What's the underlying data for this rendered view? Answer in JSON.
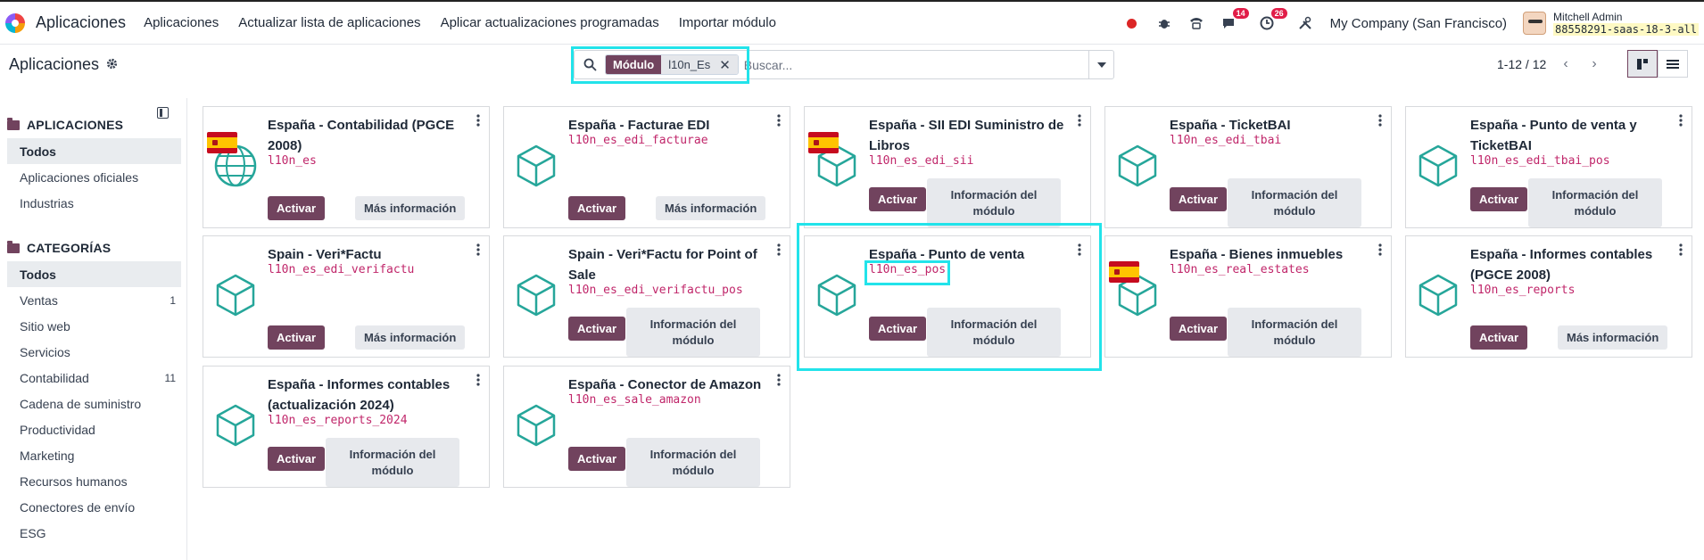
{
  "navbar": {
    "brand": "Aplicaciones",
    "links": [
      "Aplicaciones",
      "Actualizar lista de aplicaciones",
      "Aplicar actualizaciones programadas",
      "Importar módulo"
    ],
    "messages_badge": "14",
    "activities_badge": "26",
    "company": "My Company (San Francisco)",
    "user_name": "Mitchell Admin",
    "database": "88558291-saas-18-3-all"
  },
  "control": {
    "title": "Aplicaciones",
    "facet_label": "Módulo",
    "facet_value": "l10n_Es",
    "search_placeholder": "Buscar...",
    "pager": "1-12 / 12"
  },
  "sidebar": {
    "apps_header": "APLICACIONES",
    "apps_items": [
      {
        "label": "Todos",
        "count": ""
      },
      {
        "label": "Aplicaciones oficiales",
        "count": ""
      },
      {
        "label": "Industrias",
        "count": ""
      }
    ],
    "categories_header": "CATEGORÍAS",
    "category_items": [
      {
        "label": "Todos",
        "count": ""
      },
      {
        "label": "Ventas",
        "count": "1"
      },
      {
        "label": "Sitio web",
        "count": ""
      },
      {
        "label": "Servicios",
        "count": ""
      },
      {
        "label": "Contabilidad",
        "count": "11"
      },
      {
        "label": "Cadena de suministro",
        "count": ""
      },
      {
        "label": "Productividad",
        "count": ""
      },
      {
        "label": "Marketing",
        "count": ""
      },
      {
        "label": "Recursos humanos",
        "count": ""
      },
      {
        "label": "Conectores de envío",
        "count": ""
      },
      {
        "label": "ESG",
        "count": ""
      }
    ]
  },
  "buttons": {
    "activate": "Activar",
    "more_info": "Más información",
    "module_info": "Información del módulo"
  },
  "colors": {
    "primary": "#71435e",
    "technical_name": "#c0266a",
    "icon_teal": "#26a69a",
    "highlight": "#22e3ea"
  },
  "cards": [
    {
      "title": "España - Contabilidad (PGCE 2008)",
      "tech": "l10n_es",
      "icon": "globe-icon",
      "flag": true,
      "info": "more"
    },
    {
      "title": "España - Facturae EDI",
      "tech": "l10n_es_edi_facturae",
      "icon": "cube-icon",
      "flag": false,
      "info": "more"
    },
    {
      "title": "España - SII EDI Suministro de Libros",
      "tech": "l10n_es_edi_sii",
      "icon": "cube-icon",
      "flag": true,
      "info": "module"
    },
    {
      "title": "España - TicketBAI",
      "tech": "l10n_es_edi_tbai",
      "icon": "cube-icon",
      "flag": false,
      "info": "module"
    },
    {
      "title": "España - Punto de venta y TicketBAI",
      "tech": "l10n_es_edi_tbai_pos",
      "icon": "cube-icon",
      "flag": false,
      "info": "module"
    },
    {
      "title": "Spain - Veri*Factu",
      "tech": "l10n_es_edi_verifactu",
      "icon": "cube-icon",
      "flag": false,
      "info": "more"
    },
    {
      "title": "Spain - Veri*Factu for Point of Sale",
      "tech": "l10n_es_edi_verifactu_pos",
      "icon": "cube-icon",
      "flag": false,
      "info": "module"
    },
    {
      "title": "España - Punto de venta",
      "tech": "l10n_es_pos",
      "icon": "cube-icon",
      "flag": false,
      "info": "module"
    },
    {
      "title": "España - Bienes inmuebles",
      "tech": "l10n_es_real_estates",
      "icon": "cube-icon",
      "flag": true,
      "info": "module"
    },
    {
      "title": "España - Informes contables (PGCE 2008)",
      "tech": "l10n_es_reports",
      "icon": "cube-icon",
      "flag": false,
      "info": "more"
    },
    {
      "title": "España - Informes contables (actualización 2024)",
      "tech": "l10n_es_reports_2024",
      "icon": "cube-icon",
      "flag": false,
      "info": "module"
    },
    {
      "title": "España - Conector de Amazon",
      "tech": "l10n_es_sale_amazon",
      "icon": "cube-icon",
      "flag": false,
      "info": "module"
    }
  ]
}
